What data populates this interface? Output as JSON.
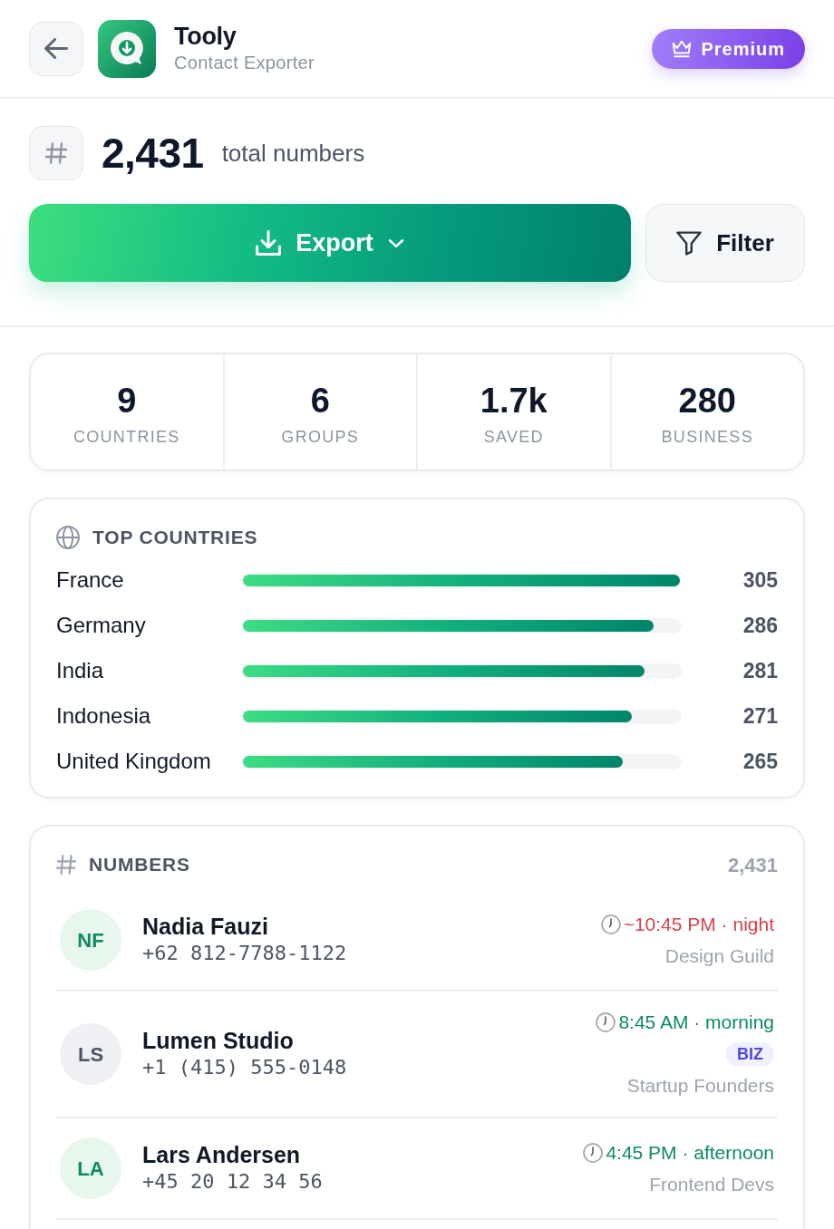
{
  "header": {
    "title": "Tooly",
    "subtitle": "Contact Exporter",
    "premium_button": "Premium"
  },
  "summary": {
    "total": "2,431",
    "total_label": "total numbers",
    "export_button": "Export",
    "filter_button": "Filter"
  },
  "stats": [
    {
      "value": "9",
      "label": "COUNTRIES"
    },
    {
      "value": "6",
      "label": "GROUPS"
    },
    {
      "value": "1.7k",
      "label": "SAVED"
    },
    {
      "value": "280",
      "label": "BUSINESS"
    }
  ],
  "top_countries": {
    "title": "TOP COUNTRIES",
    "rows": [
      {
        "name": "France",
        "level": 1.0,
        "count": "305"
      },
      {
        "name": "Germany",
        "level": 0.94,
        "count": "286"
      },
      {
        "name": "India",
        "level": 0.92,
        "count": "281"
      },
      {
        "name": "Indonesia",
        "level": 0.89,
        "count": "271"
      },
      {
        "name": "United Kingdom",
        "level": 0.87,
        "count": "265"
      }
    ]
  },
  "numbers": {
    "title": "NUMBERS",
    "count": "2,431",
    "contacts": [
      {
        "kind": "personal",
        "initials": "NF",
        "name": "Nadia Fauzi",
        "phone": "+62 812-7788-1122",
        "local_time": "~10:45 PM · night",
        "color": "#d9414b",
        "group": "Design Guild"
      },
      {
        "kind": "business",
        "initials": "LS",
        "name": "Lumen Studio",
        "phone": "+1 (415) 555-0148",
        "local_time": "8:45 AM · morning",
        "color": "#0b8a63",
        "badge": "BIZ",
        "group": "Startup Founders"
      },
      {
        "kind": "personal",
        "initials": "LA",
        "name": "Lars Andersen",
        "phone": "+45 20 12 34 56",
        "local_time": "4:45 PM · afternoon",
        "color": "#0b8a63",
        "group": "Frontend Devs"
      }
    ]
  }
}
